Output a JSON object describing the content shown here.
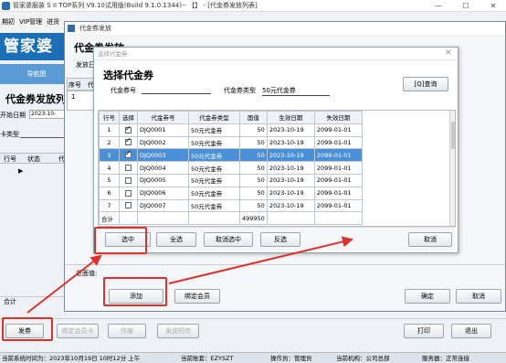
{
  "app": {
    "title": "管家婆服装 S II TOP系列 V9.10试用版(Build 9.1.0.1344)-- 【】 - [代金券发放列表]",
    "logo": "管家婆"
  },
  "menu": [
    "期初",
    "VIP管理",
    "进货"
  ],
  "nav": {
    "label": "导航图"
  },
  "page": {
    "title": "代金券发放列",
    "start_date_label": "开始日期",
    "start_date": "2023-10-",
    "card_type_label": "卡类型"
  },
  "grid": {
    "headers": [
      "行号",
      "状态",
      "代"
    ],
    "total_label": "合计"
  },
  "bottom": {
    "buttons": [
      "发券",
      "绑定会员卡",
      "作废",
      "发送短信",
      "打印",
      "退出"
    ]
  },
  "status": [
    "当前系统时间为：2023年10月19日 10时12分 上午",
    "当前账套：EZYSZT",
    "操作员：管理员",
    "当前机构：公司总部",
    "服务器：正常连接"
  ],
  "dlg1": {
    "title": "代金券发放",
    "heading": "代金券发放",
    "tab": "发放日",
    "side_headers": [
      "序号",
      "代"
    ],
    "side_row": "1",
    "total_label": "总面值:",
    "buttons": {
      "add": "添加",
      "bind": "绑定会员",
      "ok": "确定",
      "cancel": "取消"
    }
  },
  "dlg2": {
    "window_title": "选择代金券",
    "heading": "选择代金券",
    "voucher_no_label": "代金券号",
    "voucher_type_label": "代金券类型",
    "voucher_type_value": "50元代金券",
    "query_button": "[Q]查询",
    "columns": [
      "行号",
      "选择",
      "代金券号",
      "代金券类型",
      "面值",
      "生效日期",
      "失效日期"
    ],
    "rows": [
      {
        "no": "1",
        "checked": true,
        "code": "DJQ0001",
        "type": "50元代金券",
        "value": "50",
        "start": "2023-10-19",
        "end": "2099-01-01"
      },
      {
        "no": "2",
        "checked": true,
        "code": "DJQ0002",
        "type": "50元代金券",
        "value": "50",
        "start": "2023-10-19",
        "end": "2099-01-01"
      },
      {
        "no": "3",
        "checked": true,
        "code": "DJQ0003",
        "type": "50元代金券",
        "value": "50",
        "start": "2023-10-19",
        "end": "2099-01-01"
      },
      {
        "no": "4",
        "checked": false,
        "code": "DJQ0004",
        "type": "50元代金券",
        "value": "50",
        "start": "2023-10-19",
        "end": "2099-01-01"
      },
      {
        "no": "5",
        "checked": false,
        "code": "DJQ0005",
        "type": "50元代金券",
        "value": "50",
        "start": "2023-10-19",
        "end": "2099-01-01"
      },
      {
        "no": "6",
        "checked": false,
        "code": "DJQ0006",
        "type": "50元代金券",
        "value": "50",
        "start": "2023-10-19",
        "end": "2099-01-01"
      },
      {
        "no": "7",
        "checked": false,
        "code": "DJQ0007",
        "type": "50元代金券",
        "value": "50",
        "start": "2023-10-19",
        "end": "2099-01-01"
      }
    ],
    "total_label": "合计",
    "total_value": "499950",
    "buttons": {
      "select": "选中",
      "select_all": "全选",
      "deselect": "取消选中",
      "invert": "反选",
      "cancel": "取消"
    }
  },
  "colors": {
    "highlight": "#e0302a",
    "selected_row": "#4a90d9",
    "brand": "#1a6fb8"
  }
}
